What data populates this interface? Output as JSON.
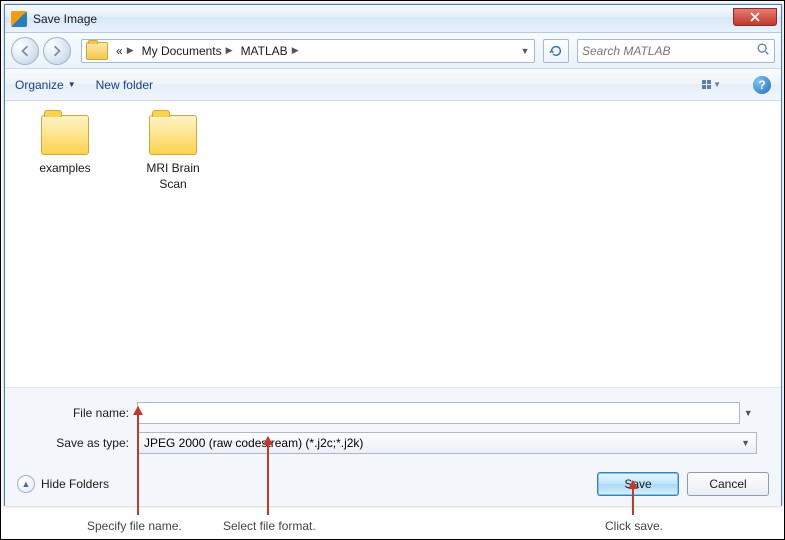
{
  "window": {
    "title": "Save Image"
  },
  "nav": {
    "crumb_prefix": "«",
    "crumb1": "My Documents",
    "crumb2": "MATLAB",
    "search_placeholder": "Search MATLAB"
  },
  "toolbar": {
    "organize": "Organize",
    "new_folder": "New folder"
  },
  "files": {
    "items": [
      {
        "name": "examples"
      },
      {
        "name": "MRI Brain Scan"
      }
    ]
  },
  "form": {
    "file_name_label": "File name:",
    "file_name_value": "",
    "save_type_label": "Save as type:",
    "save_type_value": "JPEG 2000 (raw codestream) (*.j2c;*.j2k)"
  },
  "buttons": {
    "hide_folders": "Hide Folders",
    "save": "Save",
    "cancel": "Cancel"
  },
  "annotations": {
    "a1": "Specify file name.",
    "a2": "Select file format.",
    "a3": "Click save."
  }
}
